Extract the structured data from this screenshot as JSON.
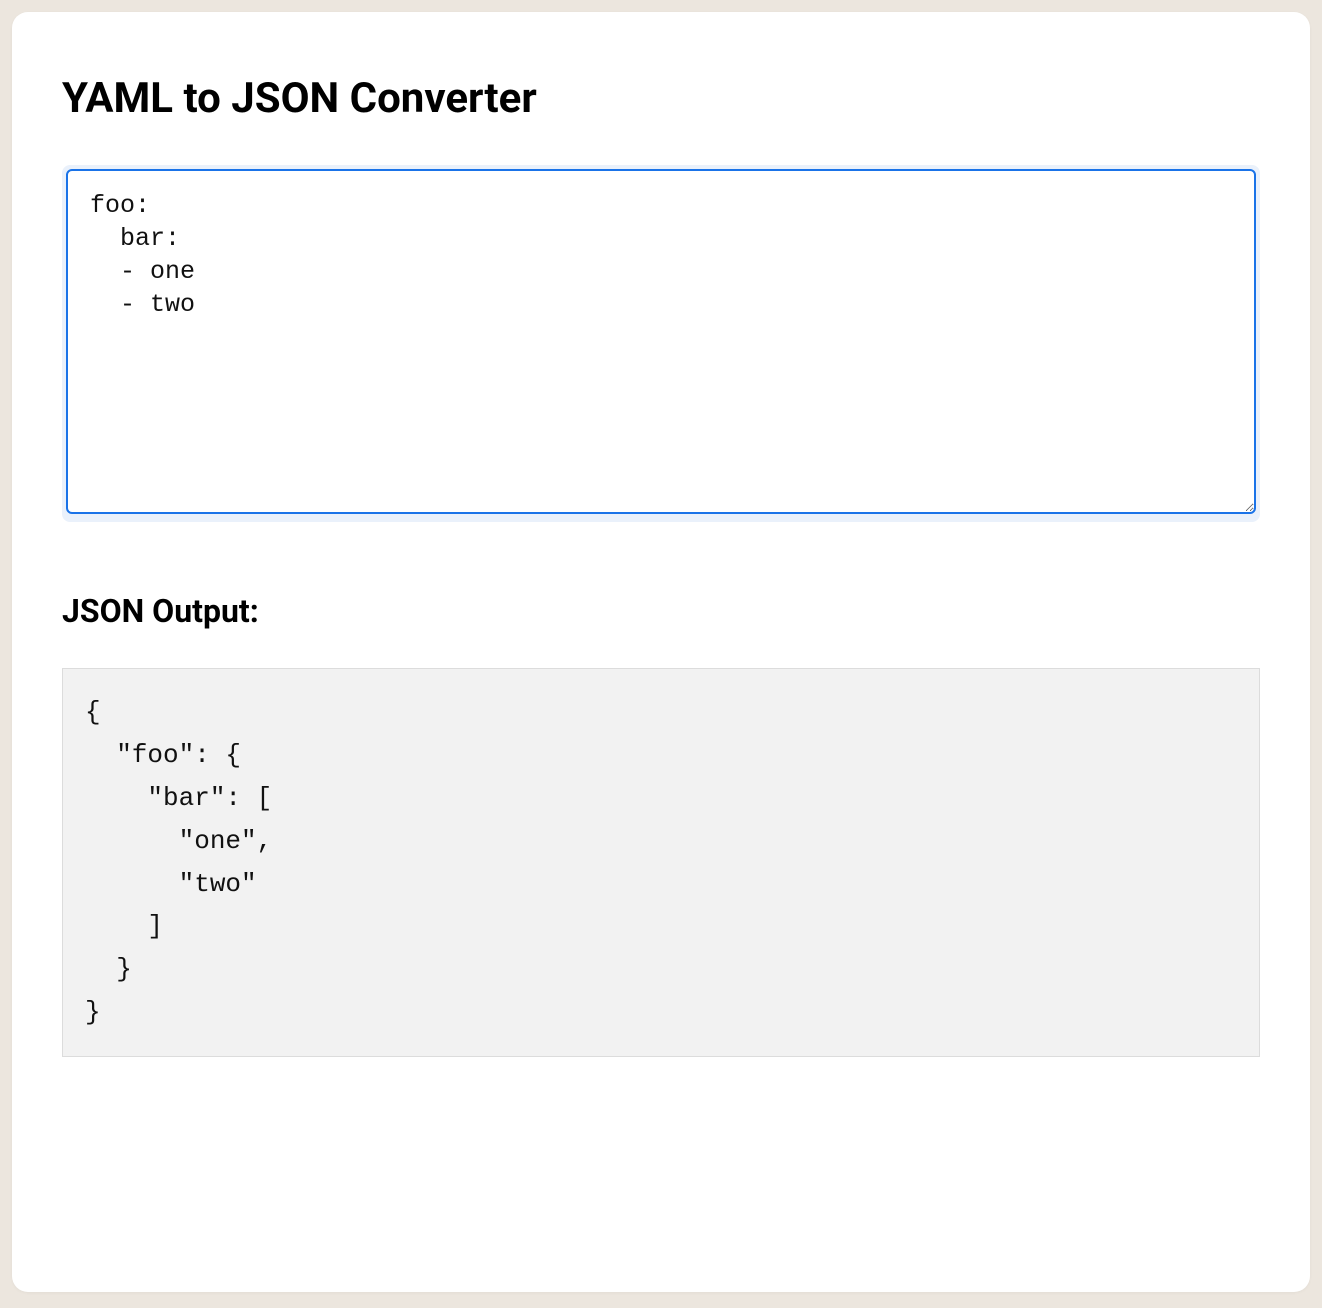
{
  "header": {
    "title": "YAML to JSON Converter"
  },
  "input": {
    "value": "foo:\n  bar:\n  - one\n  - two"
  },
  "output": {
    "label": "JSON Output:",
    "value": "{\n  \"foo\": {\n    \"bar\": [\n      \"one\",\n      \"two\"\n    ]\n  }\n}"
  }
}
